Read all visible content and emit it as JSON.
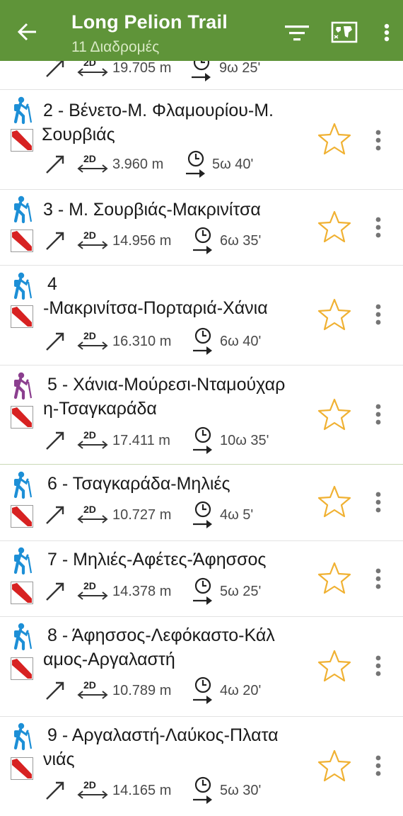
{
  "header": {
    "title": "Long Pelion Trail",
    "subtitle": "11 Διαδρομές",
    "back_icon": "arrow-back-icon",
    "filter_icon": "filter-icon",
    "map_icon": "map-icon",
    "menu_icon": "overflow-menu-icon"
  },
  "colors": {
    "appbar": "#5f9439",
    "hiker_blue": "#1d8fd6",
    "hiker_purple": "#8b3f8f",
    "blaze_red": "#d72222",
    "star_orange": "#f0b132"
  },
  "trails": [
    {
      "name": "",
      "distance": "19.705 m",
      "duration": "9ω 25'",
      "hiker": "hiker-icon-blue"
    },
    {
      "name": "2 - Βένετο-Μ. Φλαμουρίου-Μ. Σουρβιάς",
      "distance": "3.960 m",
      "duration": "5ω 40'",
      "hiker": "hiker-icon-blue"
    },
    {
      "name": "3 - Μ. Σουρβιάς-Μακρινίτσα",
      "distance": "14.956 m",
      "duration": "6ω 35'",
      "hiker": "hiker-icon-blue"
    },
    {
      "name": "4 -Μακρινίτσα-Πορταριά-Χάνια",
      "distance": "16.310 m",
      "duration": "6ω 40'",
      "hiker": "hiker-icon-blue"
    },
    {
      "name": "5 - Χάνια-Μούρεσι-Νταμούχαρη-Τσαγκαράδα",
      "distance": "17.411 m",
      "duration": "10ω 35'",
      "hiker": "hiker-icon-purple"
    },
    {
      "name": "6 - Τσαγκαράδα-Μηλιές",
      "distance": "10.727 m",
      "duration": "4ω 5'",
      "hiker": "hiker-icon-blue"
    },
    {
      "name": "7 - Μηλιές-Αφέτες-Άφησσος",
      "distance": "14.378 m",
      "duration": "5ω 25'",
      "hiker": "hiker-icon-blue"
    },
    {
      "name": "8 - Άφησσος-Λεφόκαστο-Κάλαμος-Αργαλαστή",
      "distance": "10.789 m",
      "duration": "4ω 20'",
      "hiker": "hiker-icon-blue"
    },
    {
      "name": "9 - Αργαλαστή-Λαύκος-Πλατανιάς",
      "distance": "14.165 m",
      "duration": "5ω 30'",
      "hiker": "hiker-icon-blue"
    }
  ],
  "display_lines": {
    "t1": [
      "2 - Βένετο-Μ. Φλαμουρίου-Μ.",
      "Σουρβιάς"
    ],
    "t3": [
      "4",
      "-Μακρινίτσα-Πορταριά-Χάνια"
    ],
    "t4": [
      "5 - Χάνια-Μούρεσι-Νταμούχαρ",
      "η-Τσαγκαράδα"
    ],
    "t7": [
      "8 - Άφησσος-Λεφόκαστο-Κάλ",
      "αμος-Αργαλαστή"
    ],
    "t8": [
      "9 - Αργαλαστή-Λαύκος-Πλατα",
      "νιάς"
    ]
  },
  "stat_labels": {
    "mode": "2D"
  }
}
